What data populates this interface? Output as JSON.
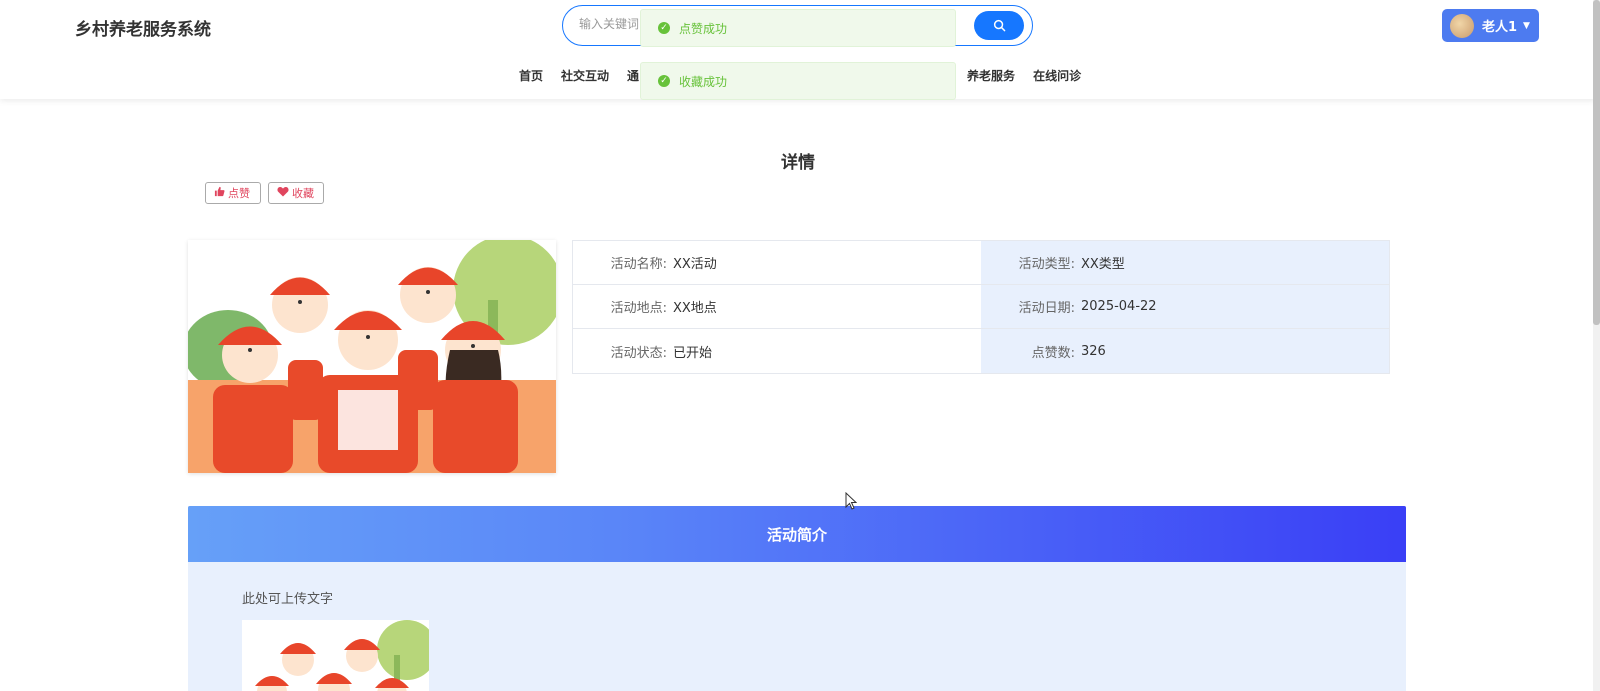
{
  "header": {
    "site_title": "乡村养老服务系统",
    "search_placeholder": "输入关键词",
    "nav": [
      "首页",
      "社交互动",
      "通",
      "养老服务",
      "在线问诊"
    ],
    "user_name": "老人1"
  },
  "toasts": [
    "点赞成功",
    "收藏成功"
  ],
  "detail": {
    "page_title": "详情",
    "like_label": "点赞",
    "favorite_label": "收藏",
    "fields": {
      "name_label": "活动名称:",
      "name_value": "XX活动",
      "type_label": "活动类型:",
      "type_value": "XX类型",
      "place_label": "活动地点:",
      "place_value": "XX地点",
      "date_label": "活动日期:",
      "date_value": "2025-04-22",
      "status_label": "活动状态:",
      "status_value": "已开始",
      "likes_label": "点赞数:",
      "likes_value": "326"
    }
  },
  "intro": {
    "heading": "活动简介",
    "text": "此处可上传文字"
  },
  "colors": {
    "primary": "#1677ff",
    "success": "#67c23a",
    "accent_pink": "#e0455e",
    "panel_blue": "#e8f0fd"
  }
}
